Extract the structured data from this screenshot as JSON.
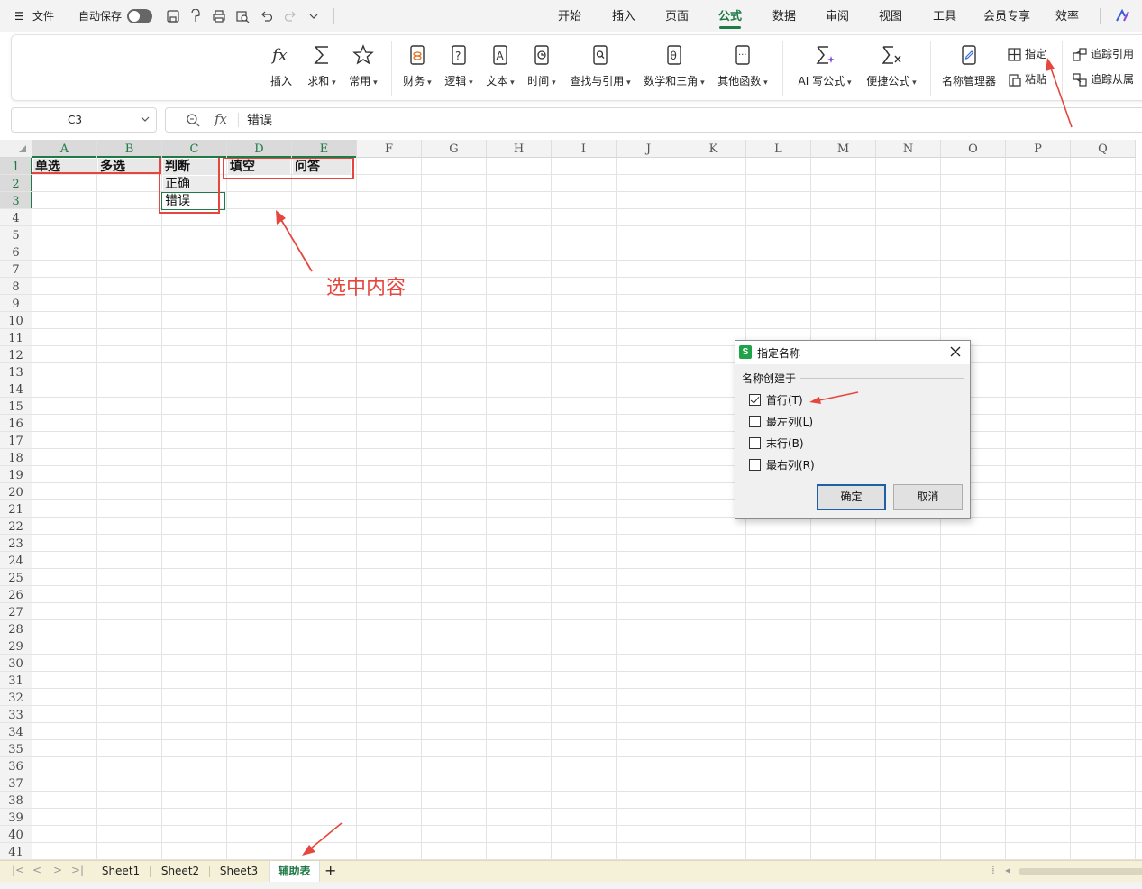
{
  "menubar": {
    "file_label": "文件",
    "autosave_label": "自动保存",
    "autosave_on": false,
    "tabs": [
      "开始",
      "插入",
      "页面",
      "公式",
      "数据",
      "审阅",
      "视图",
      "工具",
      "会员专享",
      "效率"
    ],
    "active_tab": "公式"
  },
  "ribbon": {
    "insert_fn": "插入",
    "sum": "求和",
    "common": "常用",
    "finance": "财务",
    "logic": "逻辑",
    "text": "文本",
    "time": "时间",
    "lookup": "查找与引用",
    "math": "数学和三角",
    "other": "其他函数",
    "ai": "AI 写公式",
    "quick": "便捷公式",
    "name_manager": "名称管理器",
    "define": "指定",
    "paste": "粘贴",
    "trace_precedents": "追踪引用",
    "trace_dependents": "追踪从属"
  },
  "formula_bar": {
    "name_box": "C3",
    "fx": "fx",
    "value": "错误"
  },
  "grid": {
    "columns": [
      "A",
      "B",
      "C",
      "D",
      "E",
      "F",
      "G",
      "H",
      "I",
      "J",
      "K",
      "L",
      "M",
      "N",
      "O",
      "P",
      "Q"
    ],
    "selected_columns": [
      "A",
      "B",
      "C",
      "D",
      "E"
    ],
    "selected_rows": [
      "1",
      "2",
      "3"
    ],
    "row_count": 41,
    "cells": {
      "A1": "单选",
      "B1": "多选",
      "C1": "判断",
      "D1": "填空",
      "E1": "问答",
      "C2": "正确",
      "C3": "错误"
    },
    "annotation": "选中内容"
  },
  "dialog": {
    "title": "指定名称",
    "group_label": "名称创建于",
    "options": [
      {
        "label": "首行(T)",
        "checked": true
      },
      {
        "label": "最左列(L)",
        "checked": false
      },
      {
        "label": "末行(B)",
        "checked": false
      },
      {
        "label": "最右列(R)",
        "checked": false
      }
    ],
    "ok": "确定",
    "cancel": "取消"
  },
  "sheets": {
    "tabs": [
      "Sheet1",
      "Sheet2",
      "Sheet3",
      "辅助表"
    ],
    "active": "辅助表",
    "add": "+"
  },
  "colors": {
    "accent": "#1f7a45",
    "annotation": "#e5473f",
    "dialog_primary": "#1f5fa6"
  }
}
